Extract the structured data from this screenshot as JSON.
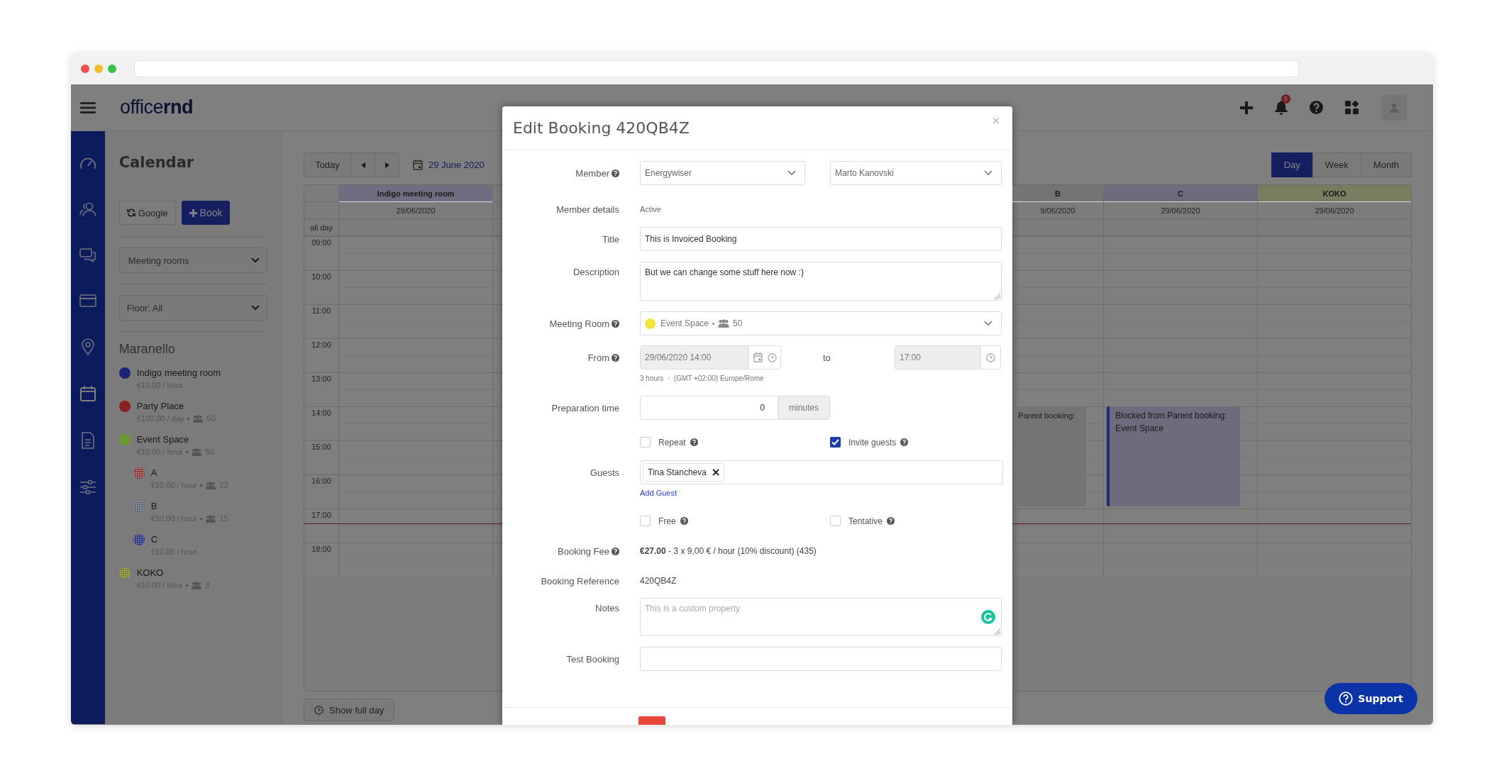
{
  "header": {
    "logo": "office**rnd**",
    "notification_count": "5"
  },
  "sidebar": {
    "title": "Calendar",
    "buttons": [
      {
        "label": "Google",
        "kind": "sync"
      },
      {
        "label": "Book",
        "kind": "add"
      }
    ],
    "filters": [
      "Meeting rooms",
      "Floor: All"
    ],
    "location": "Maranello",
    "rooms": [
      {
        "name": "Indigo meeting room",
        "price": "€10.00 / hour",
        "color": "#1e2478",
        "pattern": false
      },
      {
        "name": "Party Place",
        "price": "€100.00 / day",
        "capacity": "50",
        "color": "#8a1f1f",
        "pattern": false
      },
      {
        "name": "Event Space",
        "price": "€10.00 / hour",
        "capacity": "50",
        "color": "#6a9a30",
        "pattern": false,
        "children": [
          {
            "name": "A",
            "price": "€10.00 / hour",
            "capacity": "23",
            "color": "#8a3a3a",
            "pattern": true
          },
          {
            "name": "B",
            "price": "€10.00 / hour",
            "capacity": "15",
            "color": "#5a6470",
            "pattern": true
          },
          {
            "name": "C",
            "price": "€10.00 / hour",
            "color": "#2a3580",
            "pattern": true
          }
        ]
      },
      {
        "name": "KOKO",
        "price": "€10.00 / hour",
        "capacity": "8",
        "color": "#7a8030",
        "pattern": true
      }
    ]
  },
  "calendar": {
    "today": "Today",
    "date": "29 June 2020",
    "views": [
      {
        "label": "Day",
        "selected": true
      },
      {
        "label": "Week",
        "selected": false
      },
      {
        "label": "Month",
        "selected": false
      }
    ],
    "all_day_label": "all day",
    "hours": [
      "09:00",
      "10:00",
      "11:00",
      "12:00",
      "13:00",
      "14:00",
      "15:00",
      "16:00",
      "17:00",
      "18:00"
    ],
    "columns": [
      {
        "name": "Indigo meeting room",
        "date": "29/06/2020",
        "color": "#6e6e80"
      },
      {
        "name": "B",
        "date": "9/06/2020",
        "color": "#737575",
        "events": [
          {
            "title": "Parent booking:",
            "color": "#737575",
            "kind": "plain"
          }
        ]
      },
      {
        "name": "C",
        "date": "29/06/2020",
        "color": "#6c6c7c",
        "events": [
          {
            "title": "Blocked from Parent booking:",
            "subtitle": "Event Space",
            "color": "#6c6c7c",
            "kind": "bordered"
          }
        ]
      },
      {
        "name": "KOKO",
        "date": "29/06/2020",
        "color": "#7a7c60"
      }
    ],
    "show_full_day": "Show full day"
  },
  "modal": {
    "title": "Edit Booking 420QB4Z",
    "fields": [
      {
        "kind": "select-pair",
        "label": "Member",
        "help": true,
        "values": [
          "Energywiser",
          "Marto Kanovski"
        ]
      },
      {
        "kind": "text",
        "label": "Member details",
        "help": false,
        "value": "Active",
        "muted": true
      },
      {
        "kind": "input",
        "label": "Title",
        "help": false,
        "value": "This is Invoiced Booking"
      },
      {
        "kind": "textarea",
        "label": "Description",
        "help": false,
        "value": "But we can change some stuff here now :)"
      },
      {
        "kind": "room-select",
        "label": "Meeting Room",
        "help": true,
        "room": "Event Space",
        "capacity": "50",
        "color": "#f5e43a"
      },
      {
        "kind": "datetime",
        "label": "From",
        "help": true,
        "from": "29/06/2020 14:00",
        "to_label": "to",
        "to": "17:00",
        "hint": "3 hours  ·  (GMT +02:00) Europe/Rome"
      },
      {
        "kind": "addon-input",
        "label": "Preparation time",
        "help": false,
        "value": "0",
        "addon": "minutes"
      },
      {
        "kind": "checks",
        "options": [
          {
            "label": "Repeat",
            "help": true,
            "checked": false
          },
          {
            "label": "Invite guests",
            "help": true,
            "checked": true
          }
        ]
      },
      {
        "kind": "tags",
        "label": "Guests",
        "help": false,
        "tags": [
          "Tina Stancheva"
        ],
        "link": "Add Guest"
      },
      {
        "kind": "checks",
        "options": [
          {
            "label": "Free",
            "help": true,
            "checked": false
          },
          {
            "label": "Tentative",
            "help": true,
            "checked": false
          }
        ]
      },
      {
        "kind": "text",
        "label": "Booking Fee",
        "help": true,
        "value": "**€27.00** - 3 x 9,00 € / hour (10% discount) (435)",
        "muted": false
      },
      {
        "kind": "text",
        "label": "Booking Reference",
        "help": false,
        "value": "420QB4Z",
        "muted": false
      },
      {
        "kind": "textarea",
        "label": "Notes",
        "help": false,
        "placeholder": "This is a custom property"
      },
      {
        "kind": "input",
        "label": "Test Booking",
        "help": false
      }
    ]
  },
  "support": {
    "label": "Support"
  }
}
